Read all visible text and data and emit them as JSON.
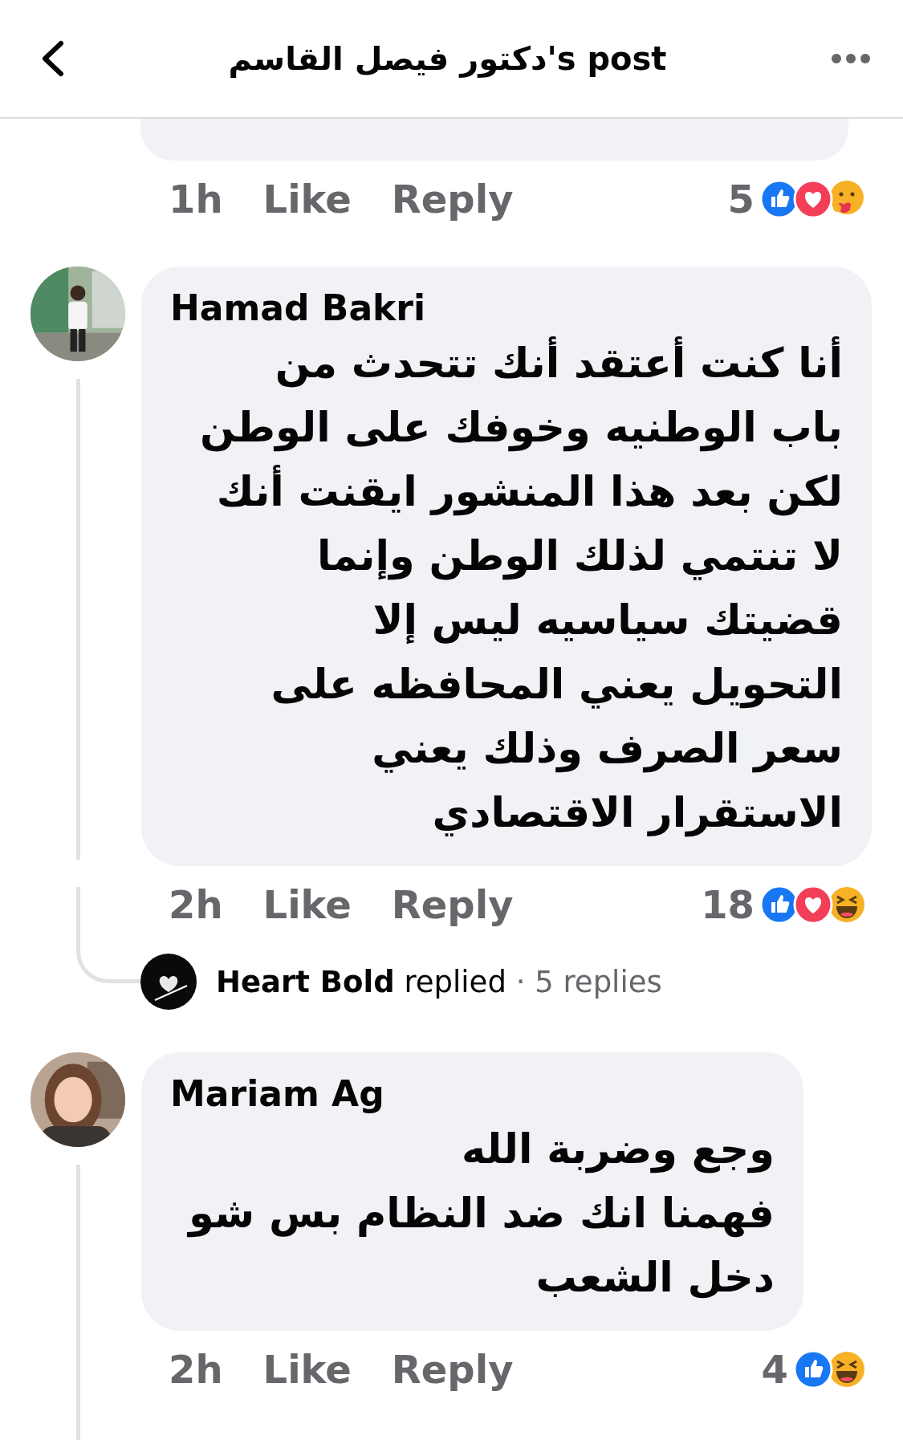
{
  "header": {
    "title": "دكتور فيصل القاسم's post"
  },
  "first_comment_meta": {
    "time": "1h",
    "like": "Like",
    "reply": "Reply",
    "reaction_count": "5",
    "reactions": [
      {
        "kind": "like"
      },
      {
        "kind": "love"
      },
      {
        "kind": "care"
      }
    ]
  },
  "comments": [
    {
      "author": "Hamad Bakri",
      "avatar": {
        "kind": "picture"
      },
      "text": "أنا كنت أعتقد أنك تتحدث من\nباب الوطنيه وخوفك على الوطن\nلكن بعد هذا المنشور ايقنت أنك\nلا تنتمي لذلك الوطن وإنما\nقضيتك سياسيه ليس إلا\nالتحويل يعني المحافظه على\nسعر الصرف وذلك يعني\nالاستقرار الاقتصادي",
      "time": "2h",
      "like": "Like",
      "reply": "Reply",
      "reaction_count": "18",
      "reactions": [
        {
          "kind": "like"
        },
        {
          "kind": "love"
        },
        {
          "kind": "haha"
        }
      ],
      "replies": {
        "name": "Heart Bold",
        "verb": "replied",
        "count": "· 5 replies"
      }
    },
    {
      "author": "Mariam Ag",
      "avatar": {
        "kind": "picture"
      },
      "text": "وجع وضربة الله\nفهمنا انك ضد النظام بس شو\nدخل الشعب",
      "time": "2h",
      "like": "Like",
      "reply": "Reply",
      "reaction_count": "4",
      "reactions": [
        {
          "kind": "like"
        },
        {
          "kind": "haha"
        }
      ]
    }
  ]
}
